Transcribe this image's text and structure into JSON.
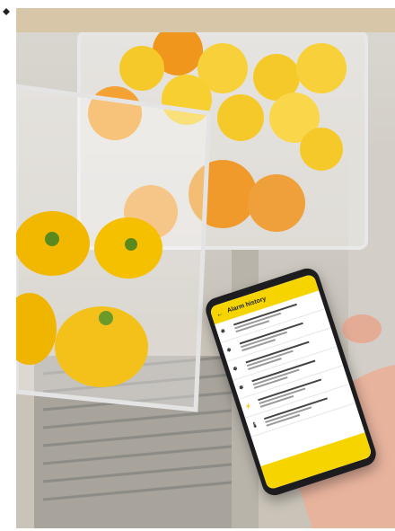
{
  "phone_app": {
    "title": "Alarm history",
    "rows": [
      {
        "icon": "snowflake-icon"
      },
      {
        "icon": "snowflake-icon"
      },
      {
        "icon": "snowflake-icon"
      },
      {
        "icon": "snowflake-icon"
      },
      {
        "icon": "lightning-icon"
      },
      {
        "icon": "thermometer-icon"
      }
    ]
  },
  "colors": {
    "banner": "#d7c6a8",
    "accent_yellow": "#f5d400",
    "lemon": "#f6c92a",
    "orange": "#f0961c"
  }
}
